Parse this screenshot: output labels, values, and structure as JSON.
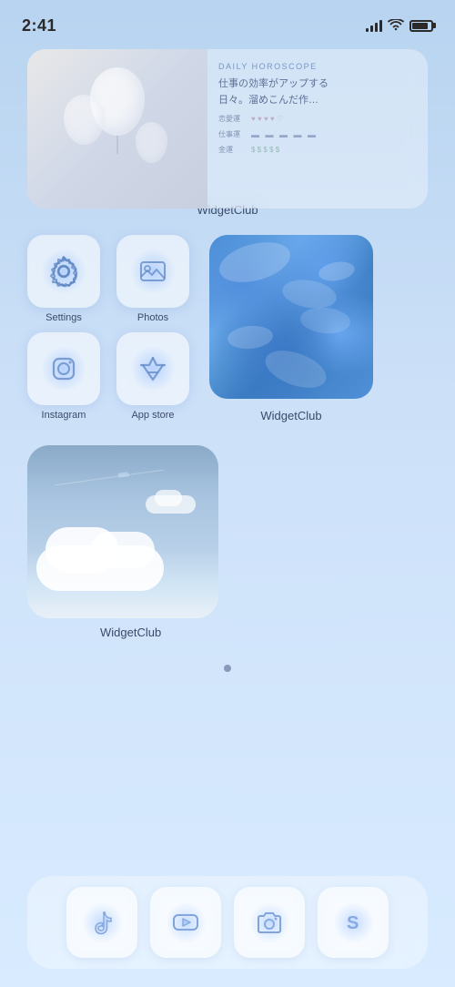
{
  "status": {
    "time": "2:41",
    "signal_bars": [
      4,
      7,
      10,
      13
    ],
    "battery_level": 85
  },
  "horoscope_widget": {
    "title": "DAILY HOROSCOPE",
    "text_line1": "仕事の効率がアップする",
    "text_line2": "日々。溜めこんだ作…",
    "love_label": "恋愛運",
    "work_label": "仕事運",
    "money_label": "金運",
    "love_icons": "♥ ♥ ♥ ♥ ♡",
    "work_icons": "📋 📋 📋 📋 📋",
    "money_icons": "$ $ $ $ $",
    "widget_name": "WidgetClub"
  },
  "apps": {
    "settings": {
      "label": "Settings"
    },
    "photos": {
      "label": "Photos"
    },
    "instagram": {
      "label": "Instagram"
    },
    "app_store": {
      "label": "App store"
    },
    "widget_club_water": {
      "label": "WidgetClub"
    },
    "widget_club_sky": {
      "label": "WidgetClub"
    }
  },
  "dock": {
    "tiktok": {
      "label": ""
    },
    "youtube": {
      "label": ""
    },
    "camera": {
      "label": ""
    },
    "safari": {
      "label": ""
    }
  },
  "colors": {
    "background_start": "#b8d4f0",
    "background_end": "#d8ebff",
    "icon_bg": "rgba(255,255,255,0.55)",
    "text_dark": "#3a4a6a",
    "accent_blue": "#6aaae8"
  }
}
